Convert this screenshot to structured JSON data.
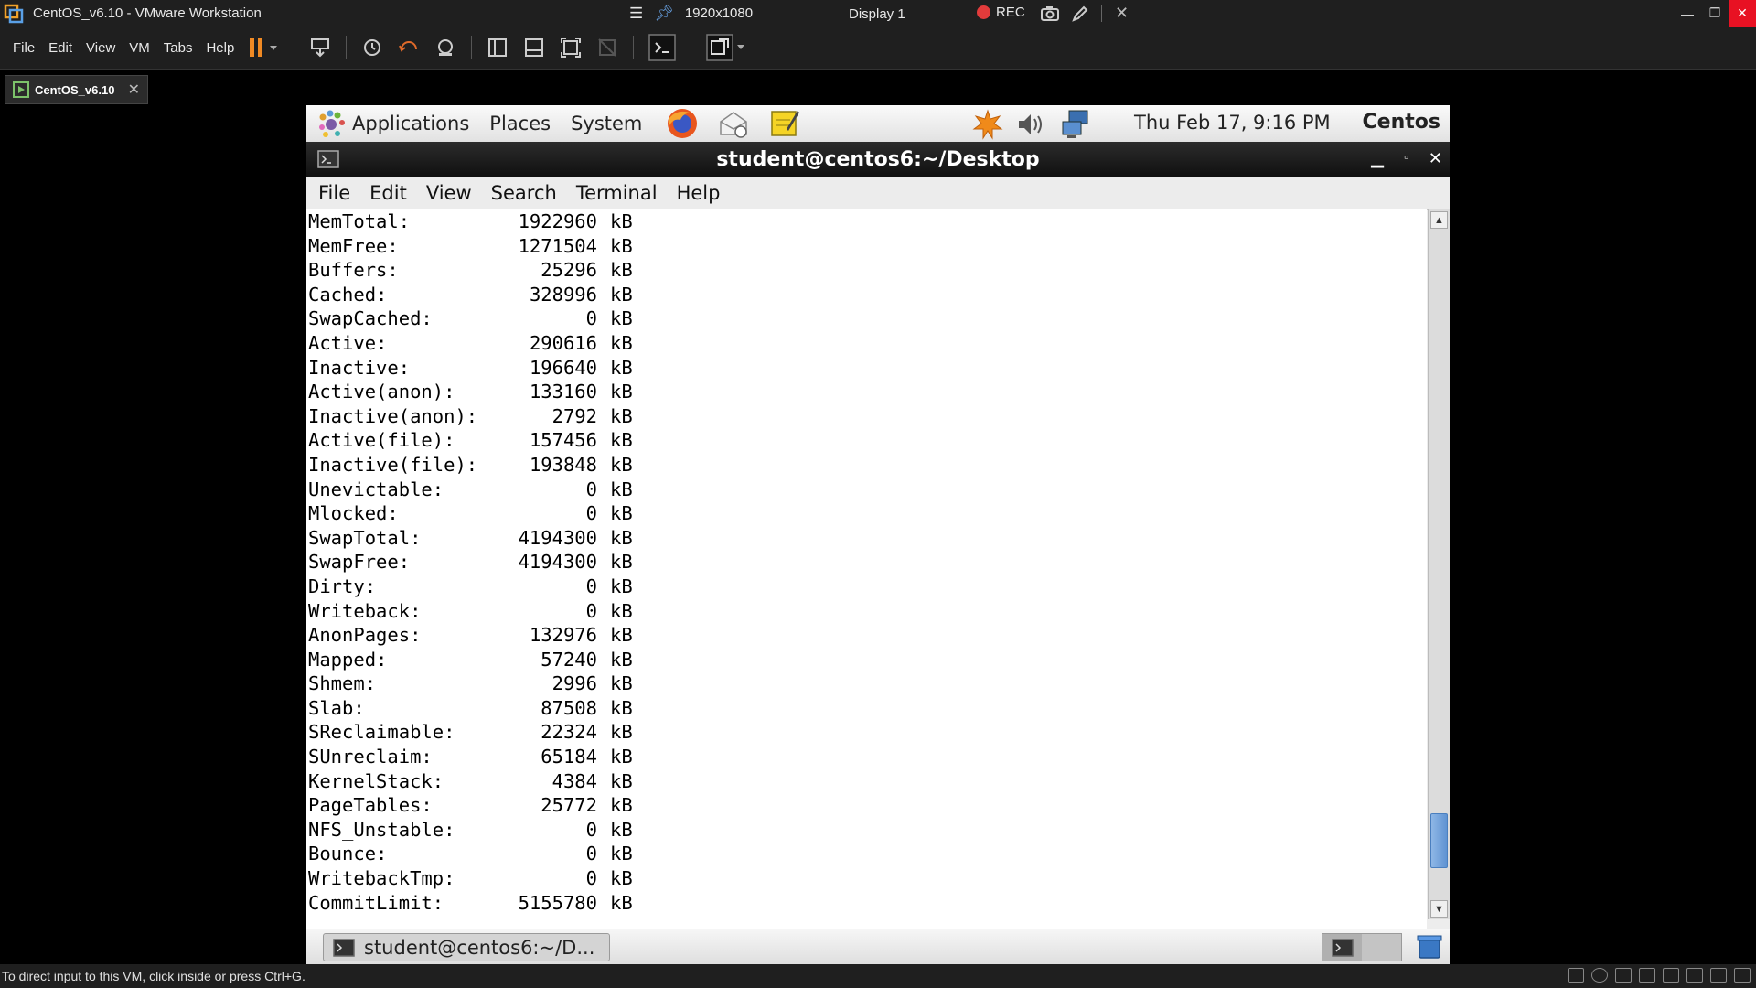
{
  "host": {
    "window_title": "CentOS_v6.10 - VMware Workstation",
    "resolution": "1920x1080",
    "display": "Display 1",
    "rec_label": "REC",
    "menu": [
      "File",
      "Edit",
      "View",
      "VM",
      "Tabs",
      "Help"
    ],
    "tab_label": "CentOS_v6.10",
    "status_message": "To direct input to this VM, click inside or press Ctrl+G."
  },
  "guest": {
    "panel": {
      "menus": [
        "Applications",
        "Places",
        "System"
      ],
      "clock": "Thu Feb 17,  9:16 PM",
      "user": "Centos"
    },
    "terminal": {
      "title": "student@centos6:~/Desktop",
      "menu": [
        "File",
        "Edit",
        "View",
        "Search",
        "Terminal",
        "Help"
      ],
      "lines": [
        {
          "key": "MemTotal:",
          "value": "1922960",
          "unit": "kB"
        },
        {
          "key": "MemFree:",
          "value": "1271504",
          "unit": "kB"
        },
        {
          "key": "Buffers:",
          "value": "25296",
          "unit": "kB"
        },
        {
          "key": "Cached:",
          "value": "328996",
          "unit": "kB"
        },
        {
          "key": "SwapCached:",
          "value": "0",
          "unit": "kB"
        },
        {
          "key": "Active:",
          "value": "290616",
          "unit": "kB"
        },
        {
          "key": "Inactive:",
          "value": "196640",
          "unit": "kB"
        },
        {
          "key": "Active(anon):",
          "value": "133160",
          "unit": "kB"
        },
        {
          "key": "Inactive(anon):",
          "value": "2792",
          "unit": "kB"
        },
        {
          "key": "Active(file):",
          "value": "157456",
          "unit": "kB"
        },
        {
          "key": "Inactive(file):",
          "value": "193848",
          "unit": "kB"
        },
        {
          "key": "Unevictable:",
          "value": "0",
          "unit": "kB"
        },
        {
          "key": "Mlocked:",
          "value": "0",
          "unit": "kB"
        },
        {
          "key": "SwapTotal:",
          "value": "4194300",
          "unit": "kB"
        },
        {
          "key": "SwapFree:",
          "value": "4194300",
          "unit": "kB"
        },
        {
          "key": "Dirty:",
          "value": "0",
          "unit": "kB"
        },
        {
          "key": "Writeback:",
          "value": "0",
          "unit": "kB"
        },
        {
          "key": "AnonPages:",
          "value": "132976",
          "unit": "kB"
        },
        {
          "key": "Mapped:",
          "value": "57240",
          "unit": "kB"
        },
        {
          "key": "Shmem:",
          "value": "2996",
          "unit": "kB"
        },
        {
          "key": "Slab:",
          "value": "87508",
          "unit": "kB"
        },
        {
          "key": "SReclaimable:",
          "value": "22324",
          "unit": "kB"
        },
        {
          "key": "SUnreclaim:",
          "value": "65184",
          "unit": "kB"
        },
        {
          "key": "KernelStack:",
          "value": "4384",
          "unit": "kB"
        },
        {
          "key": "PageTables:",
          "value": "25772",
          "unit": "kB"
        },
        {
          "key": "NFS_Unstable:",
          "value": "0",
          "unit": "kB"
        },
        {
          "key": "Bounce:",
          "value": "0",
          "unit": "kB"
        },
        {
          "key": "WritebackTmp:",
          "value": "0",
          "unit": "kB"
        },
        {
          "key": "CommitLimit:",
          "value": "5155780",
          "unit": "kB"
        }
      ]
    },
    "taskbar": {
      "task_label": "student@centos6:~/D..."
    }
  },
  "colors": {
    "host_bg": "#1f1f1f",
    "close_red": "#e81123",
    "rec_red": "#e23b3b",
    "pause_orange": "#f08a24",
    "terminal_bg": "#ffffff"
  }
}
